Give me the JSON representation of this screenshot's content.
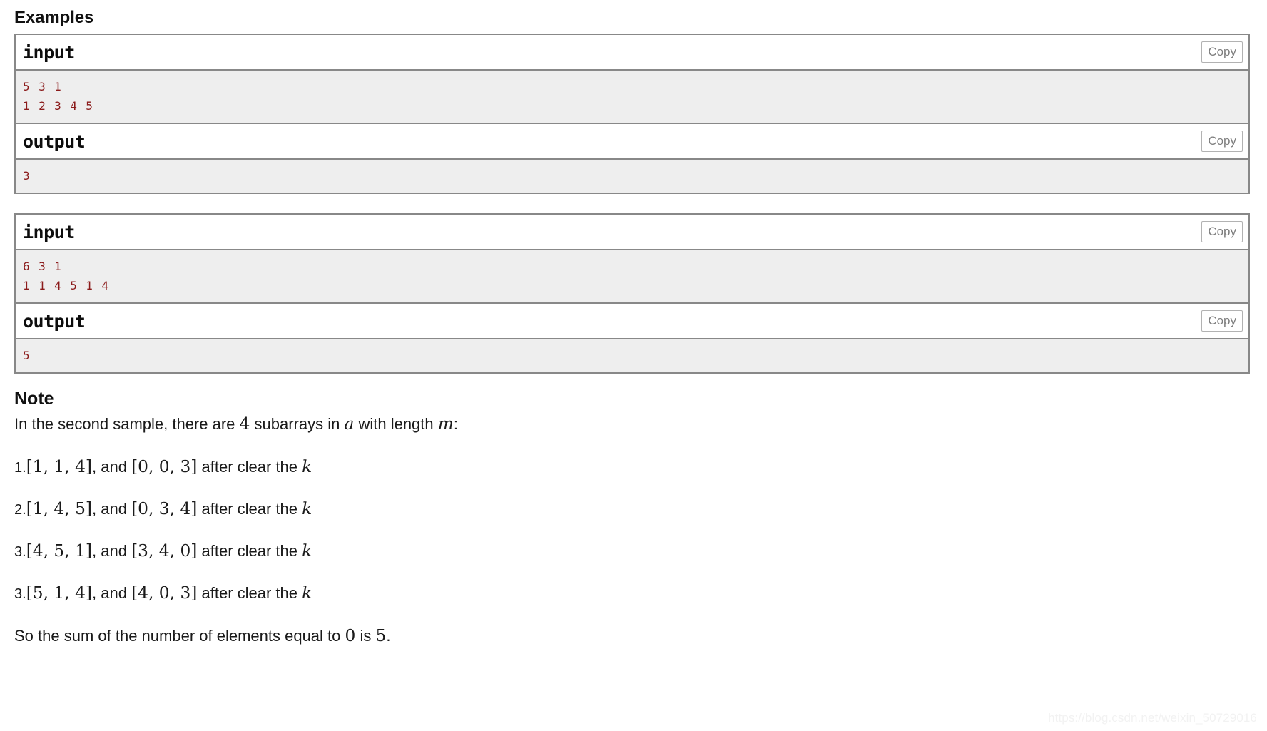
{
  "examples": {
    "heading": "Examples",
    "blocks": [
      {
        "input_label": "input",
        "input_copy_label": "Copy",
        "input_text": "5 3 1\n1 2 3 4 5",
        "output_label": "output",
        "output_copy_label": "Copy",
        "output_text": "3"
      },
      {
        "input_label": "input",
        "input_copy_label": "Copy",
        "input_text": "6 3 1\n1 1 4 5 1 4",
        "output_label": "output",
        "output_copy_label": "Copy",
        "output_text": "5"
      }
    ]
  },
  "note": {
    "heading": "Note",
    "intro": {
      "part1": "In the second sample, there are ",
      "math_count": "4",
      "part2": " subarrays in ",
      "math_a": "a",
      "part3": " with length ",
      "math_m": "m",
      "part4": ":"
    },
    "items": [
      {
        "number": "1.",
        "subarray": "[1, 1, 4]",
        "mid": ", and ",
        "result": "[0, 0, 3]",
        "tail": " after clear the ",
        "math_k": "k"
      },
      {
        "number": "2.",
        "subarray": "[1, 4, 5]",
        "mid": ", and ",
        "result": "[0, 3, 4]",
        "tail": " after clear the ",
        "math_k": "k"
      },
      {
        "number": "3.",
        "subarray": "[4, 5, 1]",
        "mid": ", and ",
        "result": "[3, 4, 0]",
        "tail": " after clear the ",
        "math_k": "k"
      },
      {
        "number": "3.",
        "subarray": "[5, 1, 4]",
        "mid": ", and ",
        "result": "[4, 0, 3]",
        "tail": " after clear the ",
        "math_k": "k"
      }
    ],
    "conclusion": {
      "part1": "So the sum of the number of elements equal to ",
      "math_zero": "0",
      "part2": " is ",
      "math_five": "5",
      "part3": "."
    }
  },
  "watermark": {
    "text": "https://blog.csdn.net/weixin_50729016"
  },
  "colors": {
    "code_text": "#8b1b1b",
    "block_border": "#888888",
    "code_background": "#eeeeee",
    "copy_button_text": "#7d7d7d",
    "copy_button_border": "#b2b2b2",
    "body_text": "#1a1a1a",
    "watermark": "#f2f2f2"
  }
}
